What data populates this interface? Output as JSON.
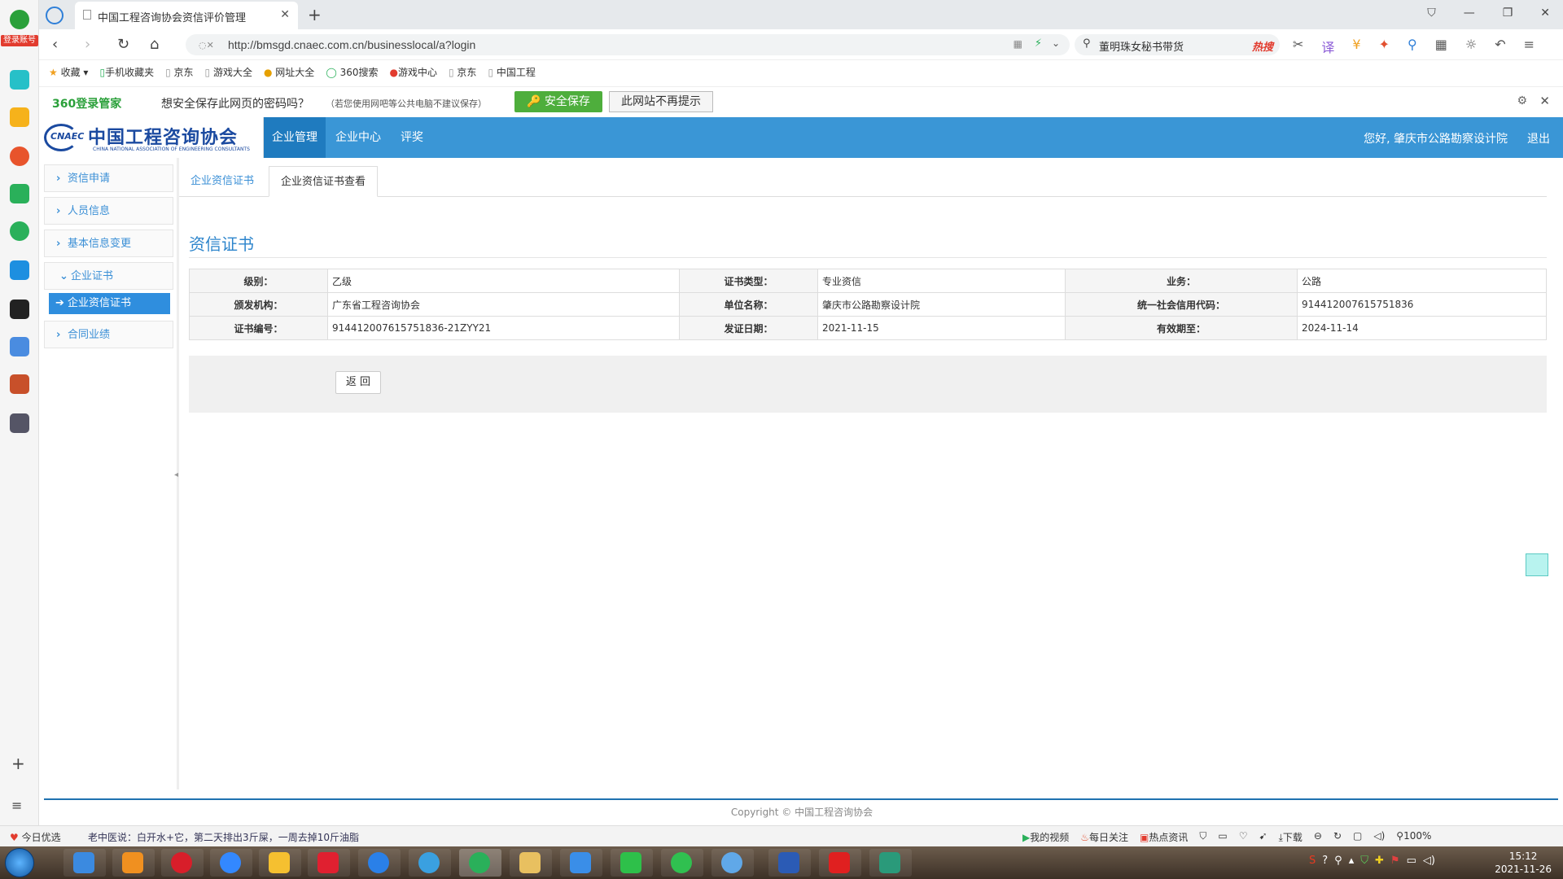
{
  "browser": {
    "tab_title": "中国工程咨询协会资信评价管理",
    "url": "http://bmsgd.cnaec.com.cn/businesslocal/a?login",
    "search_text": "董明珠女秘书带货",
    "hot_label": "热搜",
    "login_badge": "登录账号"
  },
  "bookmarks": [
    "收藏",
    "手机收藏夹",
    "京东",
    "游戏大全",
    "网址大全",
    "360搜索",
    "游戏中心",
    "京东",
    "中国工程"
  ],
  "password_bar": {
    "brand": "360登录管家",
    "message": "想安全保存此网页的密码吗？",
    "note": "（若您使用网吧等公共电脑不建议保存）",
    "save_button": "安全保存",
    "never_button": "此网站不再提示"
  },
  "site": {
    "logo_cn": "中国工程咨询协会",
    "logo_abbr": "CNAEC",
    "logo_en": "CHINA NATIONAL ASSOCIATION OF ENGINEERING CONSULTANTS",
    "nav": [
      "企业管理",
      "企业中心",
      "评奖"
    ],
    "greeting": "您好, 肇庆市公路勘察设计院",
    "logout": "退出"
  },
  "left_menu": {
    "items": [
      "资信申请",
      "人员信息",
      "基本信息变更",
      "企业证书",
      "合同业绩"
    ],
    "sub_item": "企业资信证书"
  },
  "content": {
    "tabs": [
      "企业资信证书",
      "企业资信证书查看"
    ],
    "section_title": "资信证书",
    "rows": [
      [
        "级别：",
        "乙级",
        "证书类型：",
        "专业资信",
        "业务：",
        "公路"
      ],
      [
        "颁发机构：",
        "广东省工程咨询协会",
        "单位名称：",
        "肇庆市公路勘察设计院",
        "统一社会信用代码：",
        "914412007615751836"
      ],
      [
        "证书编号：",
        "914412007615751836-21ZYY21",
        "发证日期：",
        "2021-11-15",
        "有效期至：",
        "2024-11-14"
      ]
    ],
    "back_button": "返 回"
  },
  "footer": {
    "copyright": "Copyright © 中国工程咨询协会"
  },
  "statusbar": {
    "left": "今日优选",
    "news": "老中医说：白开水+它，第二天排出3斤屎，一周去掉10斤油脂",
    "right": [
      "我的视频",
      "每日关注",
      "热点资讯",
      "下载",
      "100%"
    ]
  },
  "taskbar": {
    "time": "15:12",
    "date": "2021-11-26"
  },
  "colors": {
    "header_blue": "#3a96d6",
    "accent_blue": "#2f8ede",
    "save_green": "#4eae3c"
  }
}
